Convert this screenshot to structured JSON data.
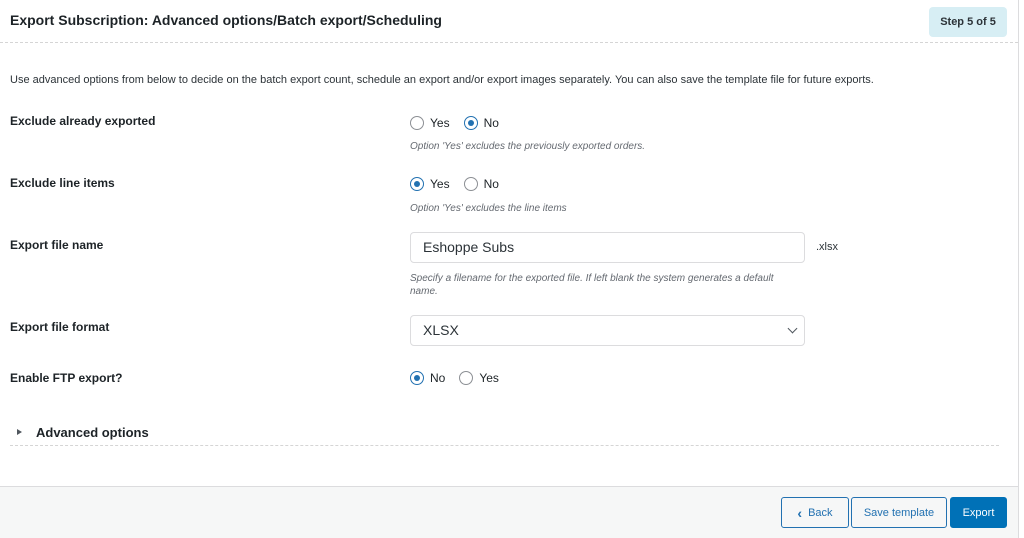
{
  "header": {
    "title": "Export Subscription: Advanced options/Batch export/Scheduling",
    "step": "Step 5 of 5"
  },
  "intro": "Use advanced options from below to decide on the batch export count, schedule an export and/or export images separately. You can also save the template file for future exports.",
  "fields": {
    "exclude_exported": {
      "label": "Exclude already exported",
      "options": [
        "Yes",
        "No"
      ],
      "selected": "No",
      "help": "Option 'Yes' excludes the previously exported orders."
    },
    "exclude_line_items": {
      "label": "Exclude line items",
      "options": [
        "Yes",
        "No"
      ],
      "selected": "Yes",
      "help": "Option 'Yes' excludes the line items"
    },
    "file_name": {
      "label": "Export file name",
      "value": "Eshoppe Subs",
      "extension": ".xlsx",
      "help": "Specify a filename for the exported file. If left blank the system generates a default name."
    },
    "file_format": {
      "label": "Export file format",
      "value": "XLSX"
    },
    "ftp": {
      "label": "Enable FTP export?",
      "options": [
        "No",
        "Yes"
      ],
      "selected": "No"
    }
  },
  "advanced": {
    "label": "Advanced options"
  },
  "footer": {
    "back": "Back",
    "save_template": "Save template",
    "export": "Export"
  },
  "colors": {
    "accent": "#2271b1",
    "primary_button": "#0071b7",
    "step_badge": "#d7eef4"
  }
}
